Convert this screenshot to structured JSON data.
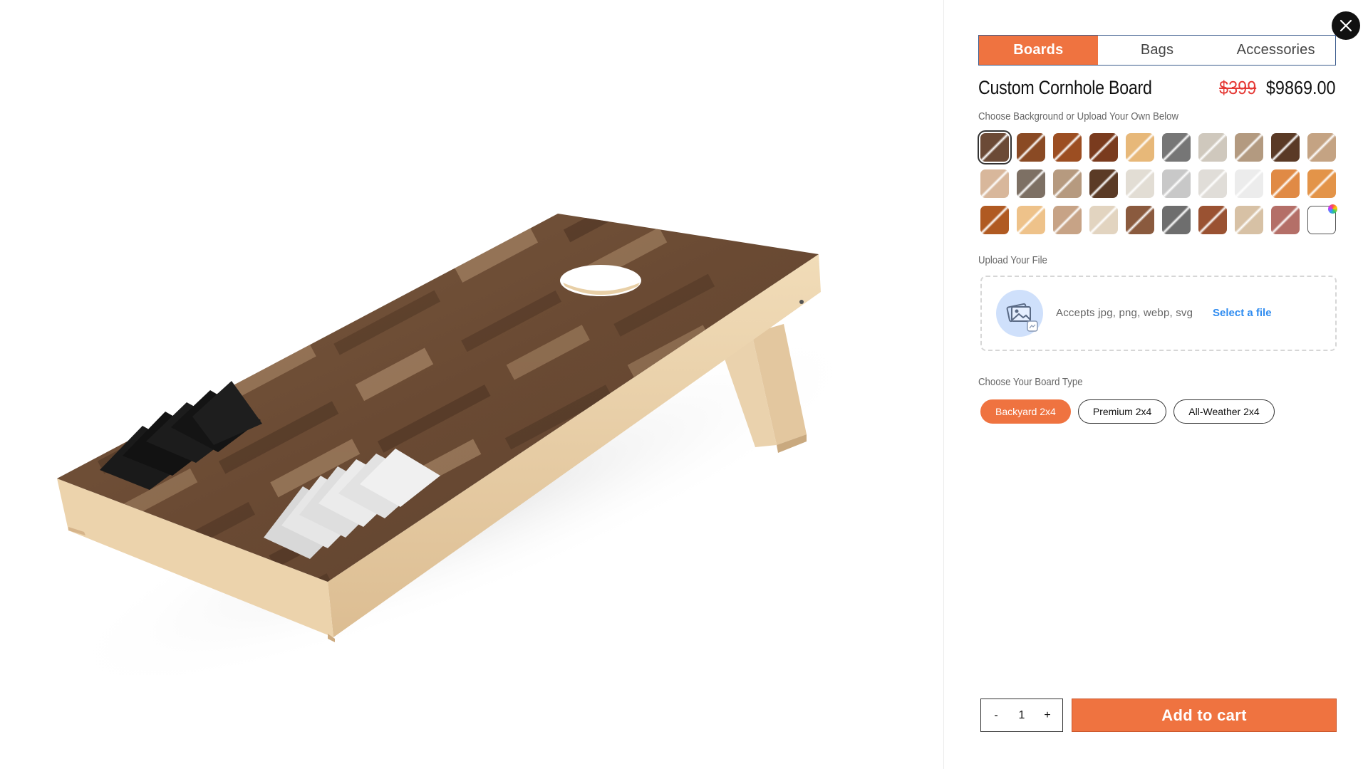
{
  "tabs": [
    {
      "label": "Boards",
      "active": true
    },
    {
      "label": "Bags",
      "active": false
    },
    {
      "label": "Accessories",
      "active": false
    }
  ],
  "product": {
    "title": "Custom Cornhole Board",
    "price_old": "$399",
    "price_new": "$9869.00"
  },
  "background": {
    "label": "Choose Background or Upload Your Own Below",
    "swatches": [
      "#6b4a36",
      "#8a4a24",
      "#9c4e22",
      "#7a3b1e",
      "#e7b879",
      "#767676",
      "#cfc8bd",
      "#b39a80",
      "#5a3a26",
      "#c4a383",
      "#d8b79b",
      "#7d7064",
      "#b69a7f",
      "#5b3b26",
      "#e2ddd4",
      "#c8c8c8",
      "#e0ddd8",
      "#ececec",
      "#e08a45",
      "#e39449",
      "#b05a22",
      "#eec28a",
      "#c7a386",
      "#e2d4c0",
      "#8a5a3e",
      "#6e6e6e",
      "#9a5232",
      "#d7c1a5",
      "#b46f68"
    ],
    "selected_index": 0,
    "custom_swatch": "custom-color"
  },
  "upload": {
    "label": "Upload Your File",
    "accepts_text": "Accepts jpg, png, webp, svg",
    "link_text": "Select a file"
  },
  "board_type": {
    "label": "Choose Your Board Type",
    "options": [
      {
        "label": "Backyard 2x4",
        "active": true
      },
      {
        "label": "Premium 2x4",
        "active": false
      },
      {
        "label": "All-Weather 2x4",
        "active": false
      }
    ]
  },
  "cart": {
    "minus": "-",
    "quantity": "1",
    "plus": "+",
    "add_label": "Add to cart"
  },
  "colors": {
    "accent": "#ef7340",
    "link": "#2f8cf0",
    "old_price": "#e53935"
  },
  "icons": {
    "close": "close-icon",
    "upload": "image-upload-icon"
  }
}
